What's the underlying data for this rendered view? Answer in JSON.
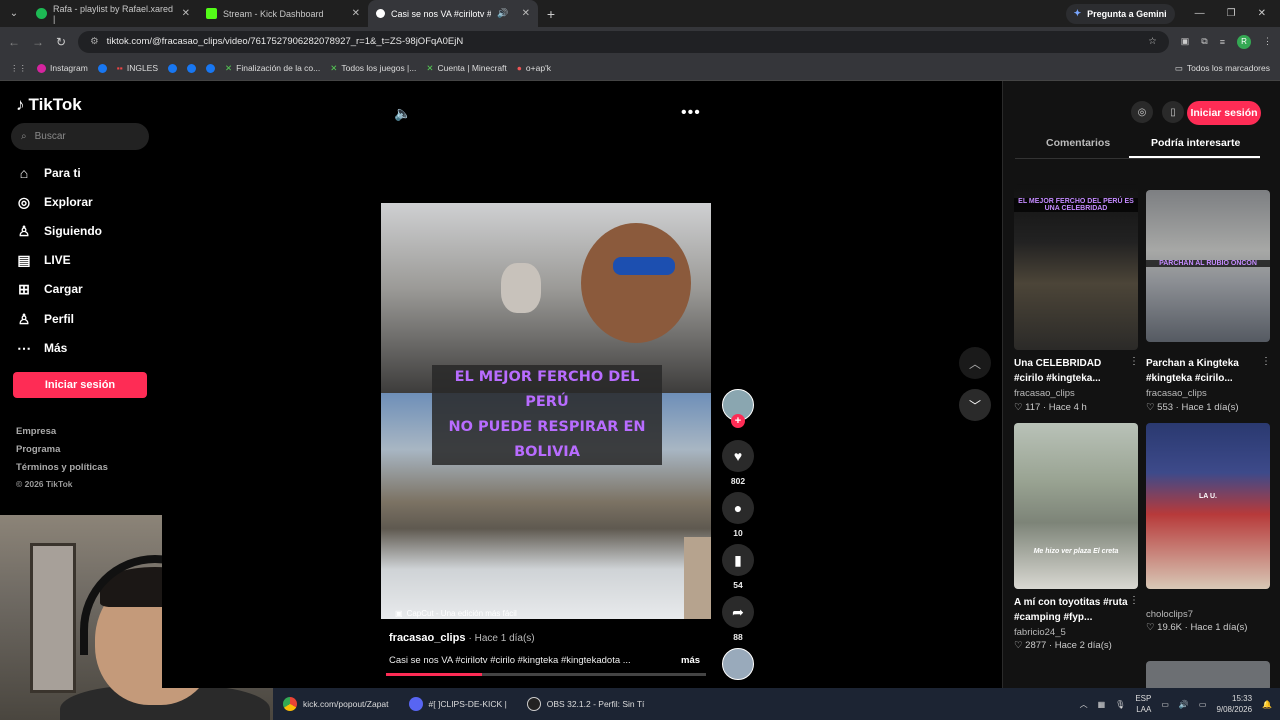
{
  "browser": {
    "tabs": [
      {
        "title": "Rafa - playlist by Rafael.xared |",
        "color": "#1db954"
      },
      {
        "title": "Stream - Kick Dashboard",
        "color": "#53fc18"
      },
      {
        "title": "Casi se nos VA #cirilotv #ci",
        "color": "#ffffff"
      }
    ],
    "gemini": "Pregunta a Gemini",
    "url": "tiktok.com/@fracasao_clips/video/7617527906282078927_r=1&_t=ZS-98jOFqA0EjN",
    "bookmarks": [
      "Instagram",
      "INGLES",
      "Finalización de la co...",
      "Todos los juegos |...",
      "Cuenta | Minecraft",
      "o+ap'k"
    ],
    "all_bookmarks": "Todos los marcadores"
  },
  "sidebar": {
    "logo": "TikTok",
    "search_placeholder": "Buscar",
    "nav": [
      {
        "label": "Para ti",
        "icon": "home-icon"
      },
      {
        "label": "Explorar",
        "icon": "compass-icon"
      },
      {
        "label": "Siguiendo",
        "icon": "following-icon"
      },
      {
        "label": "LIVE",
        "icon": "live-icon"
      },
      {
        "label": "Cargar",
        "icon": "upload-icon"
      },
      {
        "label": "Perfil",
        "icon": "profile-icon"
      },
      {
        "label": "Más",
        "icon": "more-icon"
      }
    ],
    "login": "Iniciar sesión",
    "footer": [
      "Empresa",
      "Programa",
      "Términos y políticas",
      "© 2026 TikTok"
    ]
  },
  "video": {
    "caption_line1": "EL MEJOR FERCHO DEL PERÚ",
    "caption_line2": "NO PUEDE RESPIRAR EN BOLIVIA",
    "capcut": "CapCut - Una edición más fácil",
    "username": "fracasao_clips",
    "time": "· Hace 1 día(s)",
    "description": "Casi se nos VA #cirilotv #cirilo #kingteka #kingtekadota ...",
    "more": "más",
    "progress": 0.3
  },
  "actions": {
    "likes": "802",
    "comments": "10",
    "saves": "54",
    "shares": "88"
  },
  "right_panel": {
    "login": "Iniciar sesión",
    "tabs": [
      "Comentarios",
      "Podría interesarte"
    ],
    "cards": [
      {
        "title": "Una CELEBRIDAD #cirilo #kingteka...",
        "user": "fracasao_clips",
        "likes": "117",
        "time": "Hace 4 h",
        "thumb_text": "EL MEJOR FERCHO DEL PERÚ ES UNA CELEBRIDAD"
      },
      {
        "title": "Parchan a Kingteka #kingteka #cirilo...",
        "user": "fracasao_clips",
        "likes": "553",
        "time": "Hace 1 día(s)",
        "thumb_text": "PARCHAN AL RUBIO ONCON"
      },
      {
        "title": "A mí con toyotitas #ruta #camping #fyp...",
        "user": "fabricio24_5",
        "likes": "2877",
        "time": "Hace 2 día(s)",
        "thumb_text": "Me hizo ver plaza El creta"
      },
      {
        "title": "",
        "user": "choloclips7",
        "likes": "19.6K",
        "time": "Hace 1 día(s)",
        "thumb_text": "LA U."
      }
    ]
  },
  "taskbar": {
    "items": [
      "kick.com/popout/Zapat",
      "#[ ]CLIPS-DE-KICK |",
      "OBS 32.1.2 - Perfil: Sin Tí"
    ],
    "lang1": "ESP",
    "lang2": "LAA",
    "time": "15:33",
    "date": "9/08/2026"
  }
}
